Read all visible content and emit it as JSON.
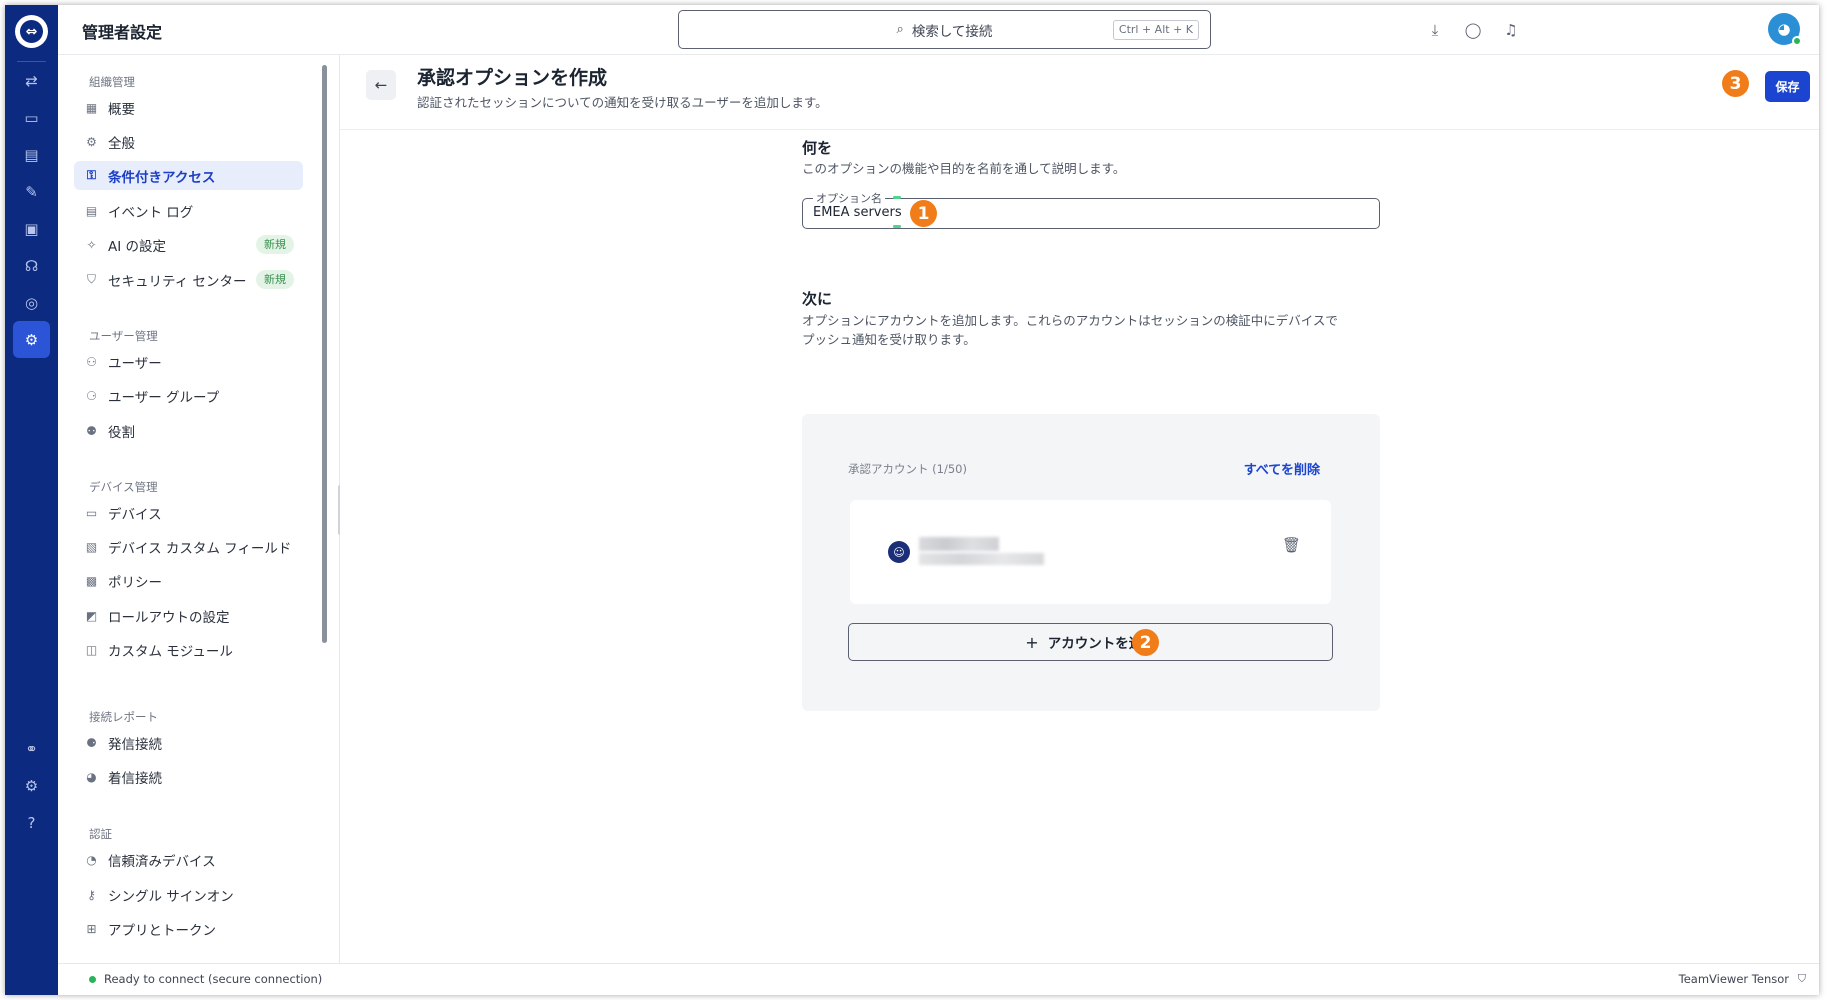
{
  "app": {
    "title": "管理者設定"
  },
  "search": {
    "placeholder": "検索して接続",
    "shortcut": "Ctrl + Alt + K"
  },
  "topbar_icons": [
    "download-icon",
    "chat-icon",
    "bell-icon"
  ],
  "sidebar": {
    "sections": [
      {
        "label": "組織管理",
        "items": [
          {
            "label": "概要",
            "icon": "overview-icon"
          },
          {
            "label": "全般",
            "icon": "gear-icon"
          },
          {
            "label": "条件付きアクセス",
            "icon": "conditional-access-icon",
            "active": true
          },
          {
            "label": "イベント ログ",
            "icon": "log-icon"
          },
          {
            "label": "AI の設定",
            "icon": "sparkle-icon",
            "badge": "新規"
          },
          {
            "label": "セキュリティ センター",
            "icon": "shield-icon",
            "badge": "新規"
          }
        ]
      },
      {
        "label": "ユーザー管理",
        "items": [
          {
            "label": "ユーザー",
            "icon": "users-icon"
          },
          {
            "label": "ユーザー グループ",
            "icon": "user-group-icon"
          },
          {
            "label": "役割",
            "icon": "role-icon"
          }
        ]
      },
      {
        "label": "デバイス管理",
        "items": [
          {
            "label": "デバイス",
            "icon": "device-icon"
          },
          {
            "label": "デバイス カスタム フィールド",
            "icon": "custom-field-icon"
          },
          {
            "label": "ポリシー",
            "icon": "policy-icon"
          },
          {
            "label": "ロールアウトの設定",
            "icon": "rollout-icon"
          },
          {
            "label": "カスタム モジュール",
            "icon": "module-icon"
          }
        ]
      },
      {
        "label": "接続レポート",
        "items": [
          {
            "label": "発信接続",
            "icon": "outgoing-icon"
          },
          {
            "label": "着信接続",
            "icon": "incoming-icon"
          }
        ]
      },
      {
        "label": "認証",
        "items": [
          {
            "label": "信頼済みデバイス",
            "icon": "trusted-device-icon"
          },
          {
            "label": "シングル サインオン",
            "icon": "key-icon"
          },
          {
            "label": "アプリとトークン",
            "icon": "apps-icon"
          }
        ]
      }
    ]
  },
  "page": {
    "title": "承認オプションを作成",
    "subtitle": "認証されたセッションについての通知を受け取るユーザーを追加します。",
    "save_label": "保存",
    "callouts": [
      "1",
      "2",
      "3"
    ]
  },
  "form": {
    "what_heading": "何を",
    "what_desc": "このオプションの機能や目的を名前を通して説明します。",
    "name_label": "オプション名",
    "name_value": "EMEA servers",
    "next_heading": "次に",
    "next_desc_1": "オプションにアカウントを追加します。これらのアカウントはセッションの検証中にデバイスで",
    "next_desc_2": "プッシュ通知を受け取ります。",
    "accounts_label": "承認アカウント (1/50)",
    "remove_all": "すべてを削除",
    "add_account": "アカウントを追加"
  },
  "status": {
    "connection": "Ready to connect (secure connection)",
    "brand": "TeamViewer Tensor"
  },
  "colors": {
    "accent": "#1b45d0",
    "rail": "#0b2a80",
    "callout": "#f07d1a",
    "online": "#29b35a"
  }
}
